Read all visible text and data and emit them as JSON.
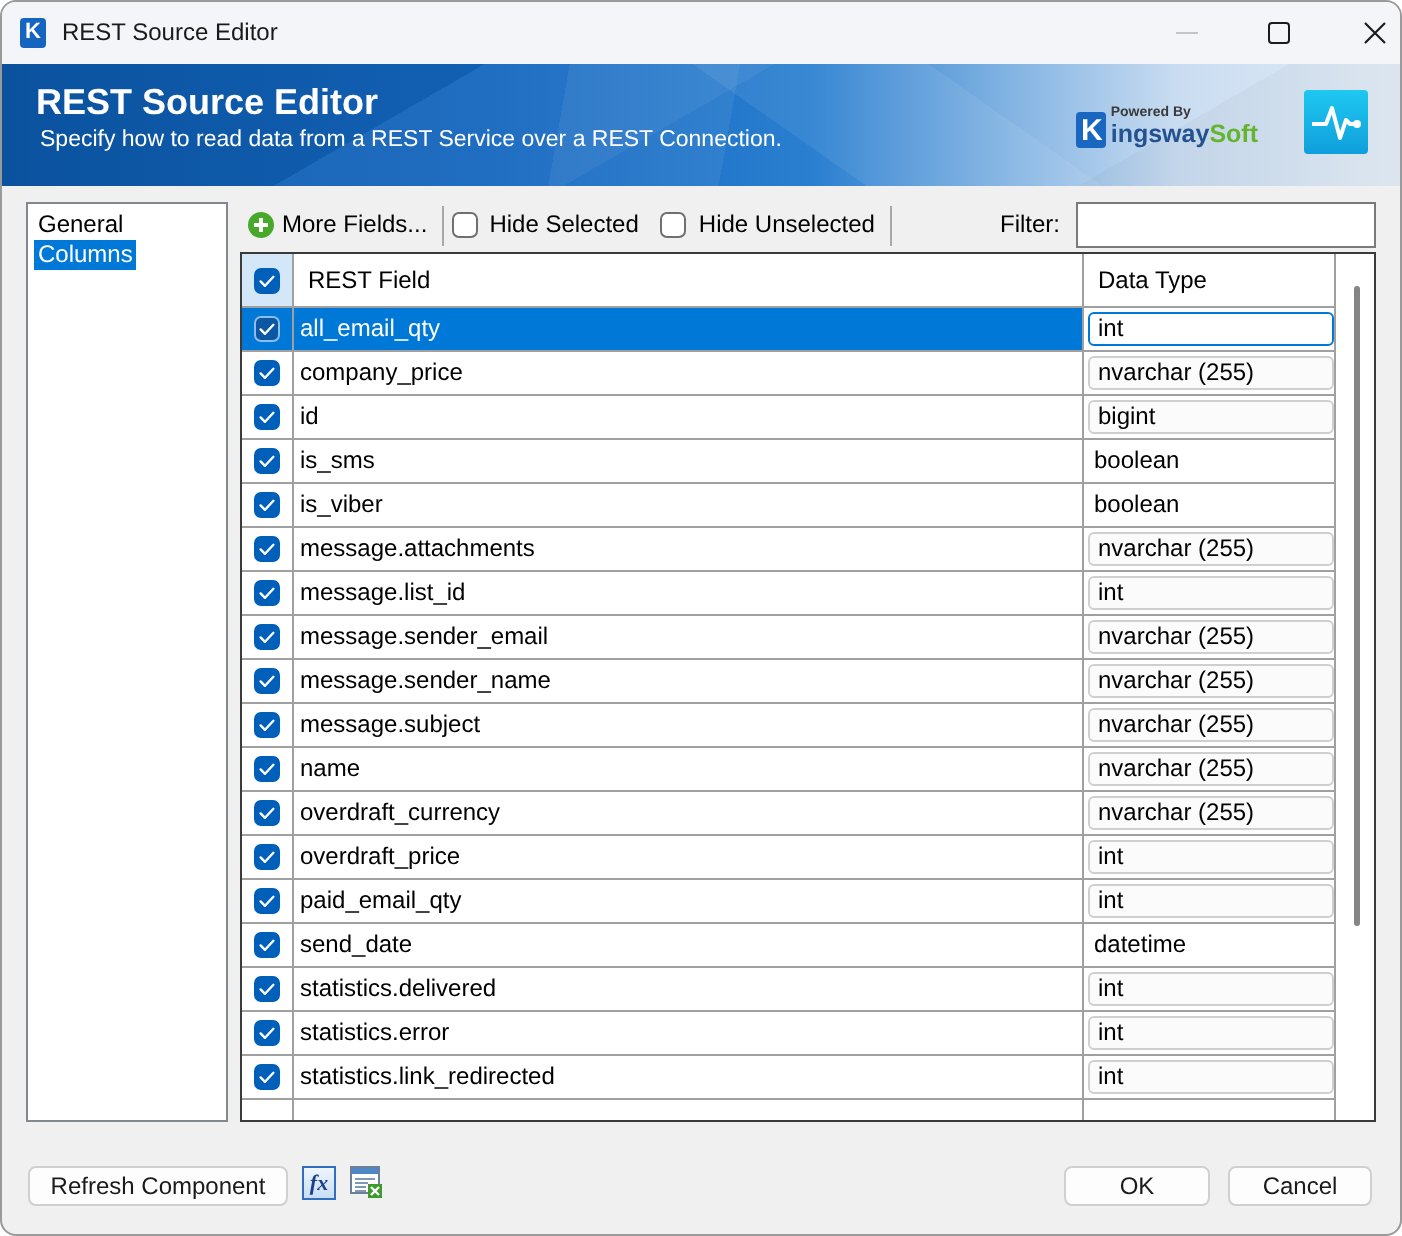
{
  "window": {
    "title": "REST Source Editor",
    "icon_letter": "K",
    "controls": [
      {
        "kind": "minimize",
        "disabled": true
      },
      {
        "kind": "maximize",
        "disabled": false
      },
      {
        "kind": "close",
        "disabled": false
      }
    ]
  },
  "header": {
    "title": "REST Source Editor",
    "subtitle": "Specify how to read data from a REST Service over a REST Connection.",
    "logo": {
      "tagline": "Powered By",
      "initial": "K",
      "name": "ingsway",
      "suffix": "Soft"
    }
  },
  "sidebar": {
    "items": [
      {
        "label": "General",
        "selected": false
      },
      {
        "label": "Columns",
        "selected": true
      }
    ]
  },
  "toolbar": {
    "more_fields": "More Fields...",
    "toggles": [
      {
        "label": "Hide Selected",
        "checked": false
      },
      {
        "label": "Hide Unselected",
        "checked": false
      }
    ],
    "filter": {
      "label": "Filter:"
    }
  },
  "table": {
    "select_all_checked": true,
    "columns": [
      "REST Field",
      "Data Type"
    ],
    "rows": [
      {
        "field": "all_email_qty",
        "data_type": "int",
        "kind": "dropdown",
        "checked": true,
        "selected": true
      },
      {
        "field": "company_price",
        "data_type": "nvarchar (255)",
        "kind": "dropdown",
        "checked": true,
        "selected": false
      },
      {
        "field": "id",
        "data_type": "bigint",
        "kind": "dropdown",
        "checked": true,
        "selected": false
      },
      {
        "field": "is_sms",
        "data_type": "boolean",
        "kind": "text",
        "checked": true,
        "selected": false
      },
      {
        "field": "is_viber",
        "data_type": "boolean",
        "kind": "text",
        "checked": true,
        "selected": false
      },
      {
        "field": "message.attachments",
        "data_type": "nvarchar (255)",
        "kind": "dropdown",
        "checked": true,
        "selected": false
      },
      {
        "field": "message.list_id",
        "data_type": "int",
        "kind": "dropdown",
        "checked": true,
        "selected": false
      },
      {
        "field": "message.sender_email",
        "data_type": "nvarchar (255)",
        "kind": "dropdown",
        "checked": true,
        "selected": false
      },
      {
        "field": "message.sender_name",
        "data_type": "nvarchar (255)",
        "kind": "dropdown",
        "checked": true,
        "selected": false
      },
      {
        "field": "message.subject",
        "data_type": "nvarchar (255)",
        "kind": "dropdown",
        "checked": true,
        "selected": false
      },
      {
        "field": "name",
        "data_type": "nvarchar (255)",
        "kind": "dropdown",
        "checked": true,
        "selected": false
      },
      {
        "field": "overdraft_currency",
        "data_type": "nvarchar (255)",
        "kind": "dropdown",
        "checked": true,
        "selected": false
      },
      {
        "field": "overdraft_price",
        "data_type": "int",
        "kind": "dropdown",
        "checked": true,
        "selected": false
      },
      {
        "field": "paid_email_qty",
        "data_type": "int",
        "kind": "dropdown",
        "checked": true,
        "selected": false
      },
      {
        "field": "send_date",
        "data_type": "datetime",
        "kind": "text",
        "checked": true,
        "selected": false
      },
      {
        "field": "statistics.delivered",
        "data_type": "int",
        "kind": "dropdown",
        "checked": true,
        "selected": false
      },
      {
        "field": "statistics.error",
        "data_type": "int",
        "kind": "dropdown",
        "checked": true,
        "selected": false
      },
      {
        "field": "statistics.link_redirected",
        "data_type": "int",
        "kind": "dropdown",
        "checked": true,
        "selected": false
      }
    ]
  },
  "footer": {
    "refresh": "Refresh Component",
    "expression": "fx",
    "ok": "OK",
    "cancel": "Cancel"
  }
}
